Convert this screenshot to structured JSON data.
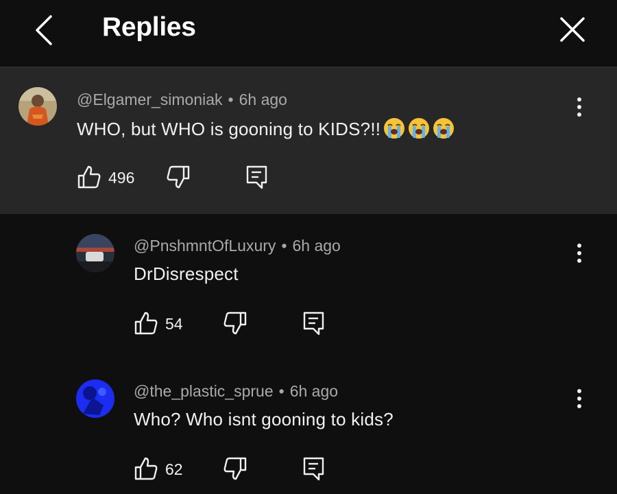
{
  "header": {
    "title": "Replies",
    "back_icon": "chevron-left-icon",
    "close_icon": "close-icon"
  },
  "parent_comment": {
    "author": "@Elgamer_simoniak",
    "time": "6h ago",
    "text": "WHO, but WHO is gooning to KIDS?!!",
    "emojis": [
      "loudly-crying-face",
      "loudly-crying-face",
      "loudly-crying-face"
    ],
    "likes": "496"
  },
  "replies": [
    {
      "author": "@PnshmntOfLuxury",
      "time": "6h ago",
      "text": "DrDisrespect",
      "likes": "54"
    },
    {
      "author": "@the_plastic_sprue",
      "time": "6h ago",
      "text": "Who? Who isnt gooning to kids?",
      "likes": "62"
    }
  ],
  "colors": {
    "background": "#0f0f0f",
    "highlight": "#272727",
    "text": "#f1f1f1",
    "secondary_text": "#aaaaaa"
  }
}
